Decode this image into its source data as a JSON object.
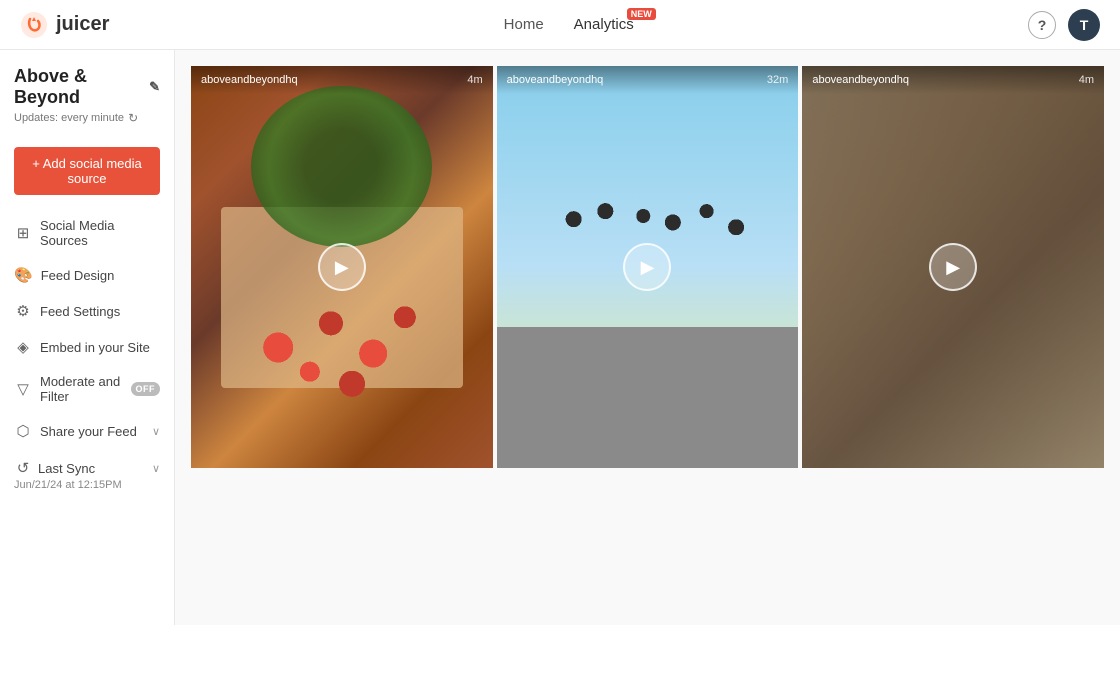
{
  "app": {
    "logo_text": "juicer",
    "avatar_letter": "T"
  },
  "header": {
    "nav": [
      {
        "id": "home",
        "label": "Home",
        "active": false,
        "badge": null
      },
      {
        "id": "analytics",
        "label": "Analytics",
        "active": false,
        "badge": "NEW"
      }
    ],
    "help_label": "?",
    "avatar_label": "T"
  },
  "sidebar": {
    "feed_name": "Above & Beyond",
    "updates_label": "Updates: every minute",
    "add_source_btn": "+ Add social media source",
    "nav_items": [
      {
        "id": "social-media-sources",
        "label": "Social Media Sources",
        "icon": "⊞",
        "toggle": null,
        "chevron": false
      },
      {
        "id": "feed-design",
        "label": "Feed Design",
        "icon": "🖌",
        "toggle": null,
        "chevron": false
      },
      {
        "id": "feed-settings",
        "label": "Feed Settings",
        "icon": "⚙",
        "toggle": null,
        "chevron": false
      },
      {
        "id": "embed-in-your-site",
        "label": "Embed in your Site",
        "icon": "⬡",
        "toggle": null,
        "chevron": false
      },
      {
        "id": "moderate-and-filter",
        "label": "Moderate and Filter",
        "icon": "▽",
        "toggle": "OFF",
        "chevron": false
      },
      {
        "id": "share-your-feed",
        "label": "Share your Feed",
        "icon": "⬡",
        "toggle": null,
        "chevron": true
      }
    ],
    "last_sync_label": "Last Sync",
    "last_sync_date": "Jun/21/24 at 12:15PM",
    "last_sync_chevron": true
  },
  "feed": {
    "cards": [
      {
        "id": 1,
        "username": "aboveandbeyondhq",
        "time": "4m",
        "has_play": true,
        "bg_class": "card-bg-1"
      },
      {
        "id": 2,
        "username": "aboveandbeyondhq",
        "time": "32m",
        "has_play": true,
        "bg_class": "card-bg-2"
      },
      {
        "id": 3,
        "username": "aboveandbeyondhq",
        "time": "4m",
        "has_play": true,
        "bg_class": "card-bg-3"
      }
    ]
  }
}
